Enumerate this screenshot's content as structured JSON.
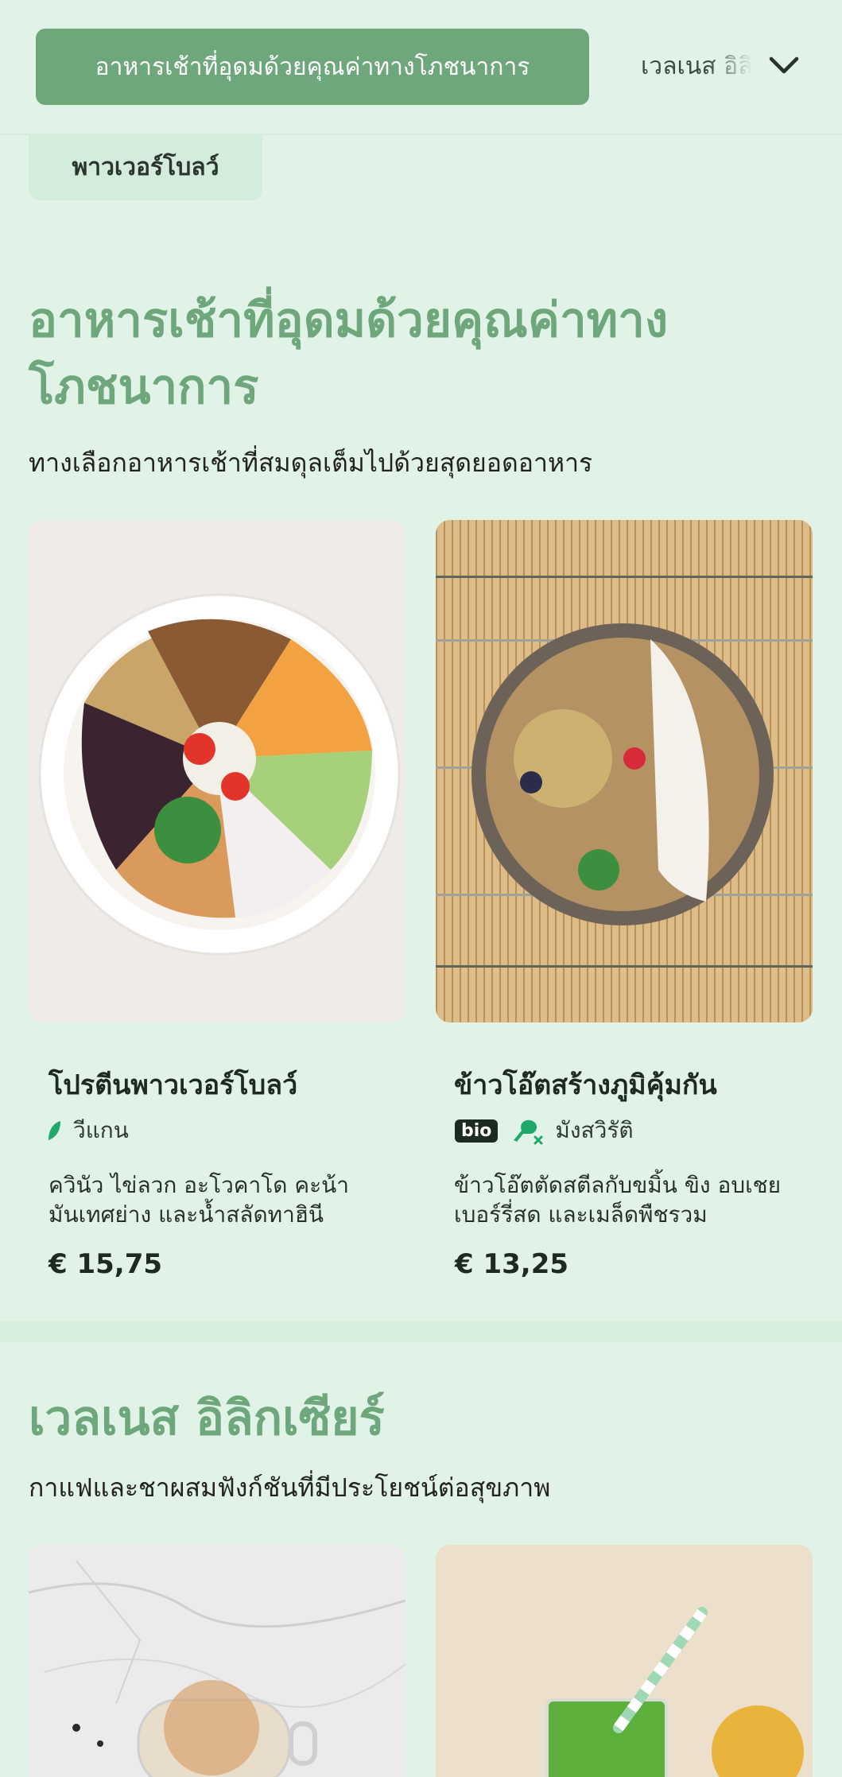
{
  "nav": {
    "active_tab": "อาหารเช้าที่อุดมด้วยคุณค่าทางโภชนาการ",
    "next_tab": "เวลเนส อิลิกเซียร์",
    "sub_chip": "พาวเวอร์โบลว์"
  },
  "section1": {
    "title": "อาหารเช้าที่อุดมด้วยคุณค่าทางโภชนาการ",
    "subtitle": "ทางเลือกอาหารเช้าที่สมดุลเต็มไปด้วยสุดยอดอาหาร",
    "cards": [
      {
        "title": "โปรตีนพาวเวอร์โบลว์",
        "tag": "วีแกน",
        "description": "ควินัว ไข่ลวก อะโวคาโด คะน้า มันเทศย่าง และน้ำสลัดทาฮินี",
        "price": "€ 15,75"
      },
      {
        "title": "ข้าวโอ๊ตสร้างภูมิคุ้มกัน",
        "badge": "bio",
        "tag": "มังสวิรัติ",
        "description": "ข้าวโอ๊ตตัดสตีลกับขมิ้น ขิง อบเชย เบอร์รี่สด และเมล็ดพืชรวม",
        "price": "€ 13,25"
      }
    ]
  },
  "section2": {
    "title": "เวลเนส อิลิกเซียร์",
    "subtitle": "กาแฟและชาผสมฟังก์ชันที่มีประโยชน์ต่อสุขภาพ"
  },
  "icons": {
    "chevron": "chevron-down-icon",
    "vegan": "leaf-icon",
    "vegetarian": "no-meat-icon"
  },
  "colors": {
    "background": "#e1f3e7",
    "accent": "#6fa77c",
    "tag_green": "#20a86a"
  }
}
